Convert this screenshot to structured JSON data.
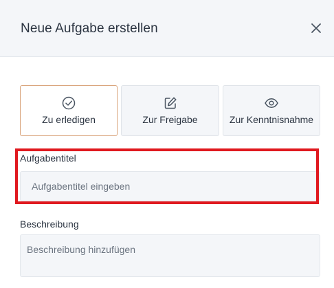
{
  "dialog": {
    "title": "Neue Aufgabe erstellen",
    "close_icon": "close-icon"
  },
  "task_types": [
    {
      "label": "Zu erledigen",
      "icon": "check-circle-icon",
      "selected": true
    },
    {
      "label": "Zur Freigabe",
      "icon": "edit-pencil-icon",
      "selected": false
    },
    {
      "label": "Zur Kenntnisnahme",
      "icon": "eye-icon",
      "selected": false
    }
  ],
  "form": {
    "title_label": "Aufgabentitel",
    "title_value": "",
    "title_placeholder": "Aufgabentitel eingeben",
    "description_label": "Beschreibung",
    "description_value": "",
    "description_placeholder": "Beschreibung hinzufügen"
  },
  "colors": {
    "header_bg": "#f4f6f9",
    "selected_border": "#d9a37a",
    "highlight": "#e0191f",
    "icon": "#4a5562"
  }
}
